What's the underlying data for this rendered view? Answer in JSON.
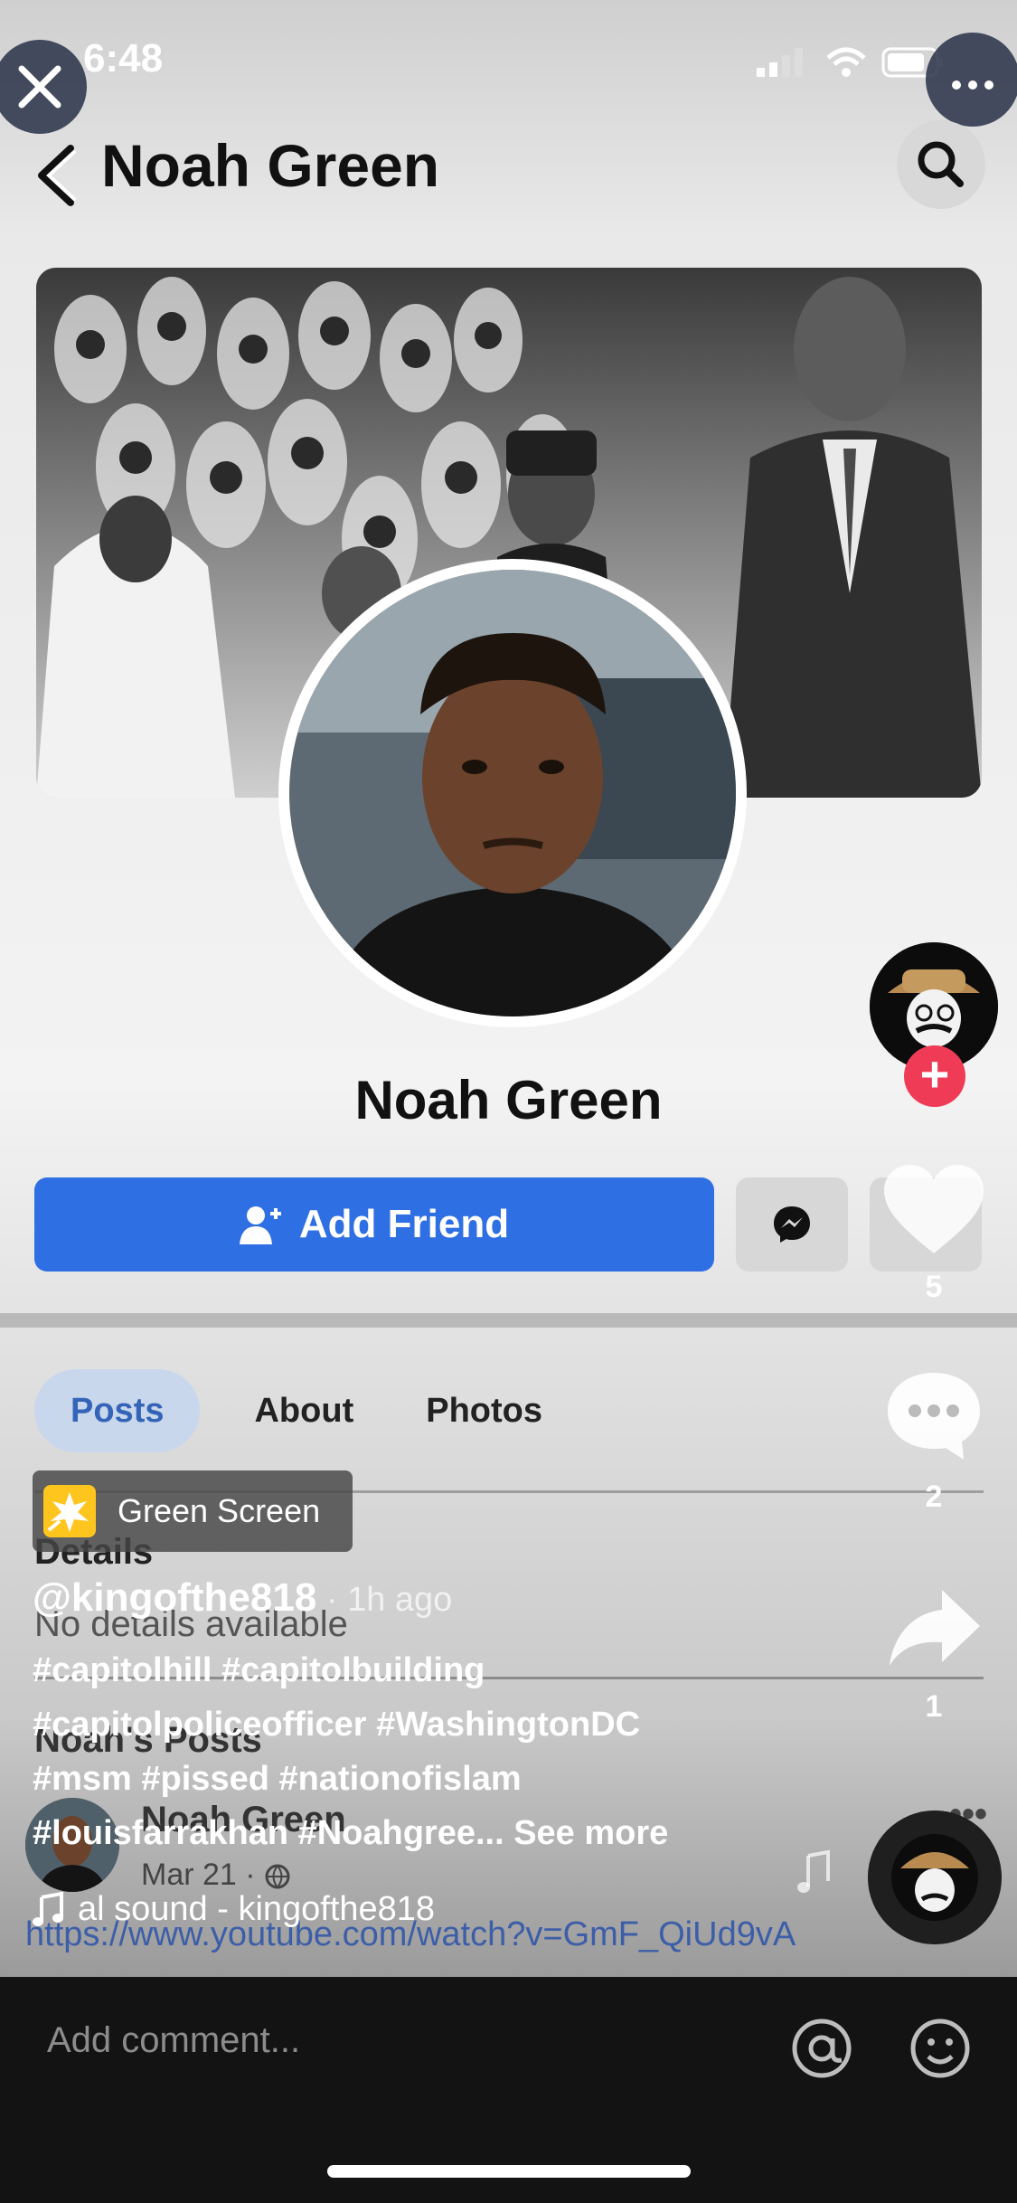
{
  "status": {
    "time": "6:48"
  },
  "fb": {
    "header_name": "Noah Green",
    "profile_name": "Noah Green",
    "add_friend_label": "Add Friend",
    "tabs": [
      "Posts",
      "About",
      "Photos"
    ],
    "details_title": "Details",
    "details_text": "No details available",
    "posts_title": "Noah's Posts",
    "post_author": "Noah Green",
    "post_date": "Mar 21 · ",
    "post_link": "https://www.youtube.com/watch?v=GmF_QiUd9vA"
  },
  "tiktok": {
    "effect_label": "Green Screen",
    "username": "@kingofthe818",
    "time_ago": " · 1h ago",
    "hashtag_lines": [
      "#capitolhill #capitolbuilding",
      "#capitolpoliceofficer #WashingtonDC",
      "#msm #pissed #nationofislam",
      "#louisfarrakhan #Noahgree..."
    ],
    "see_more": " See more",
    "sound": "al sound - kingofthe818",
    "like_count": "5",
    "comment_count": "2",
    "share_count": "1",
    "comment_placeholder": "Add comment..."
  },
  "colors": {
    "fb_blue": "#2f6fe4",
    "follow_red": "#ef3b56",
    "tab_active_bg": "#c9d7ec"
  },
  "icons": [
    "close-icon",
    "more-icon",
    "back-icon",
    "search-icon",
    "add-friend-icon",
    "messenger-icon",
    "heart-icon",
    "comment-icon",
    "share-icon",
    "music-note-icon",
    "at-icon",
    "emoji-icon",
    "globe-icon"
  ]
}
